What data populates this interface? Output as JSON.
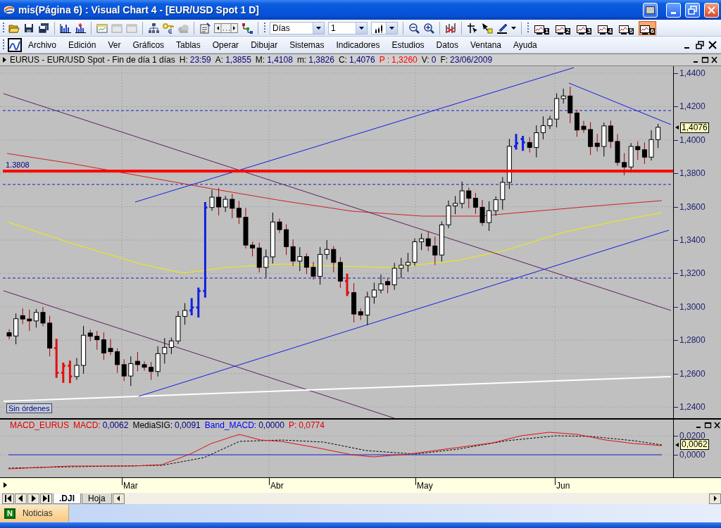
{
  "window": {
    "title": "mis(Página 6) : Visual Chart 4 - [EUR/USD Spot 1 D]"
  },
  "toolbar": {
    "period": "Días",
    "interval": "1",
    "layouts": [
      {
        "label": "1",
        "selected": false
      },
      {
        "label": "2",
        "selected": false
      },
      {
        "label": "3",
        "selected": false
      },
      {
        "label": "4",
        "selected": false
      },
      {
        "label": "5",
        "selected": false
      },
      {
        "label": "6",
        "selected": true
      }
    ]
  },
  "menu": [
    "Archivo",
    "Edición",
    "Ver",
    "Gráficos",
    "Tablas",
    "Operar",
    "Dibujar",
    "Sistemas",
    "Indicadores",
    "Estudios",
    "Datos",
    "Ventana",
    "Ayuda"
  ],
  "chart": {
    "info": [
      {
        "text": "EURUS - EUR/USD Spot - Fin de día 1 días",
        "kind": "label"
      },
      {
        "text": "H:",
        "kind": "label"
      },
      {
        "text": "23:59",
        "kind": "value"
      },
      {
        "text": "A:",
        "kind": "label"
      },
      {
        "text": "1,3855",
        "kind": "value"
      },
      {
        "text": "M:",
        "kind": "label"
      },
      {
        "text": "1,4108",
        "kind": "value"
      },
      {
        "text": "m:",
        "kind": "label"
      },
      {
        "text": "1,3826",
        "kind": "value"
      },
      {
        "text": "C:",
        "kind": "label"
      },
      {
        "text": "1,4076",
        "kind": "value"
      },
      {
        "text": "P :",
        "kind": "alert-label"
      },
      {
        "text": "1,3260",
        "kind": "alert-value"
      },
      {
        "text": "V:",
        "kind": "label"
      },
      {
        "text": "0",
        "kind": "value"
      },
      {
        "text": "F:",
        "kind": "label"
      },
      {
        "text": "23/06/2009",
        "kind": "value"
      }
    ],
    "price_axis": [
      "1,4400",
      "1,4200",
      "1,4000",
      "1,3800",
      "1,3600",
      "1,3400",
      "1,3200",
      "1,3000",
      "1,2800",
      "1,2600",
      "1,2400"
    ],
    "last_price": "1,4076",
    "level_label": "1.3808",
    "orders_label": "Sin órdenes",
    "macd": {
      "legend": [
        {
          "text": "MACD_EURUS",
          "kind": "label",
          "color": "#e00000"
        },
        {
          "text": "MACD:",
          "kind": "label",
          "color": "#e00000"
        },
        {
          "text": "0,0062",
          "kind": "value",
          "color": "#000080"
        },
        {
          "text": "MediaSIG:",
          "kind": "label",
          "color": "#000000"
        },
        {
          "text": "0,0091",
          "kind": "value",
          "color": "#000080"
        },
        {
          "text": "Band_MACD:",
          "kind": "label",
          "color": "#0000ff"
        },
        {
          "text": "0,0000",
          "kind": "value",
          "color": "#000080"
        },
        {
          "text": "P:",
          "kind": "label",
          "color": "#e00000"
        },
        {
          "text": "0,0774",
          "kind": "value",
          "color": "#e00000"
        }
      ],
      "axis": [
        "0,0200",
        "0,0000"
      ],
      "last_value": "0,0062"
    },
    "months": [
      "Mar",
      "Abr",
      "May",
      "Jun"
    ]
  },
  "sheet_tabs": [
    {
      "label": ".DJI",
      "selected": true
    },
    {
      "label": "Hoja",
      "selected": false
    }
  ],
  "taskbar": [
    {
      "badge": "N",
      "label": "Noticias"
    }
  ]
}
